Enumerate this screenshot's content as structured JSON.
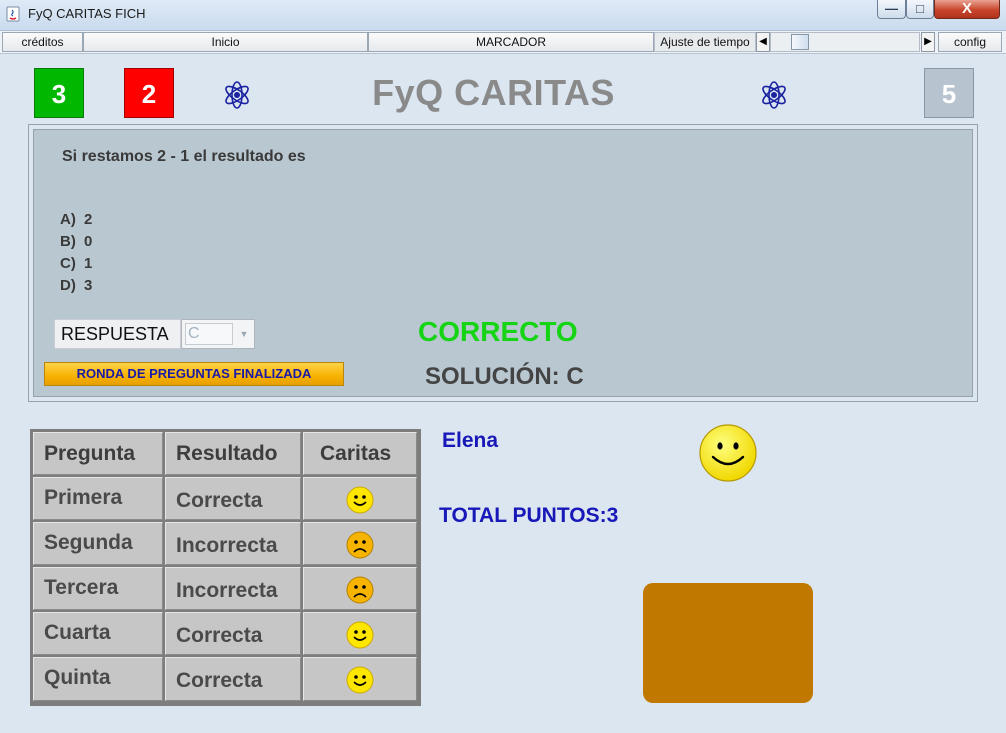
{
  "window": {
    "title": "FyQ CARITAS FICH",
    "minimize_glyph": "—",
    "maximize_glyph": "□",
    "close_glyph": "X"
  },
  "toolbar": {
    "creditos": "créditos",
    "inicio": "Inicio",
    "marcador": "MARCADOR",
    "ajuste_tiempo": "Ajuste de tiempo",
    "config": "config",
    "left_arrow": "◀",
    "right_arrow": "▶"
  },
  "scores": {
    "green": "3",
    "red": "2",
    "grey": "5"
  },
  "title": "FyQ CARITAS",
  "question": {
    "text": "Si restamos 2 - 1 el resultado es",
    "options": [
      {
        "letter": "A)",
        "value": "2"
      },
      {
        "letter": "B)",
        "value": "0"
      },
      {
        "letter": "C)",
        "value": "1"
      },
      {
        "letter": "D)",
        "value": "3"
      }
    ]
  },
  "respuesta": {
    "label": "RESPUESTA",
    "value": "C"
  },
  "finish_button": "RONDA DE PREGUNTAS FINALIZADA",
  "feedback": {
    "status": "CORRECTO",
    "solucion_label": "SOLUCIÓN:",
    "solucion_value": "C"
  },
  "table": {
    "headers": [
      "Pregunta",
      "Resultado",
      "Caritas"
    ],
    "rows": [
      {
        "pregunta": "Primera",
        "resultado": "Correcta",
        "face": "happy-face-icon"
      },
      {
        "pregunta": "Segunda",
        "resultado": "Incorrecta",
        "face": "sad-face-icon"
      },
      {
        "pregunta": "Tercera",
        "resultado": "Incorrecta",
        "face": "sad-face-icon"
      },
      {
        "pregunta": "Cuarta",
        "resultado": "Correcta",
        "face": "happy-face-icon"
      },
      {
        "pregunta": "Quinta",
        "resultado": "Correcta",
        "face": "happy-face-icon"
      }
    ]
  },
  "student": {
    "name": "Elena",
    "total_label": "TOTAL PUNTOS:",
    "total_value": "3"
  },
  "colors": {
    "green": "#00b800",
    "red": "#ff0000",
    "accent_blue": "#1818b8",
    "correct_green": "#14d414",
    "brown_box": "#c17800"
  }
}
